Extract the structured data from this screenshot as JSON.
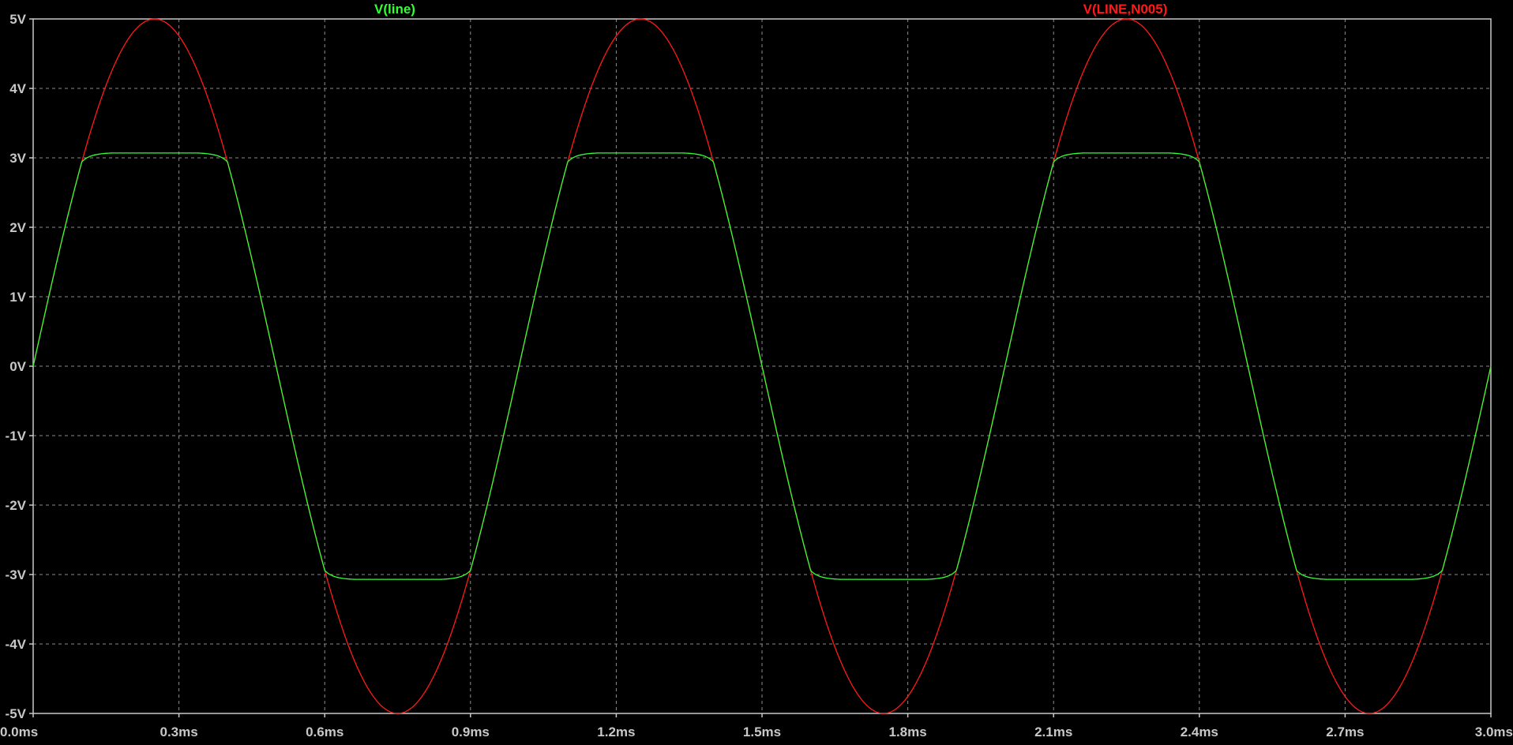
{
  "chart_data": {
    "type": "line",
    "title": "",
    "xlabel": "",
    "ylabel": "",
    "grid": true,
    "legend_placement": "top",
    "x_unit": "ms",
    "y_unit": "V",
    "xlim": [
      0,
      3.0
    ],
    "ylim": [
      -5,
      5
    ],
    "x_ticks": [
      0.0,
      0.3,
      0.6,
      0.9,
      1.2,
      1.5,
      1.8,
      2.1,
      2.4,
      2.7,
      3.0
    ],
    "x_tick_labels": [
      "0.0ms",
      "0.3ms",
      "0.6ms",
      "0.9ms",
      "1.2ms",
      "1.5ms",
      "1.8ms",
      "2.1ms",
      "2.4ms",
      "2.7ms",
      "3.0ms"
    ],
    "y_ticks": [
      5,
      4,
      3,
      2,
      1,
      0,
      -1,
      -2,
      -3,
      -4,
      -5
    ],
    "y_tick_labels": [
      "5V",
      "4V",
      "3V",
      "2V",
      "1V",
      "0V",
      "-1V",
      "-2V",
      "-3V",
      "-4V",
      "-5V"
    ],
    "series": [
      {
        "name": "V(LINE,N005)",
        "color": "#ff1a1a",
        "x": [
          0.0,
          0.05,
          0.1,
          0.15,
          0.2,
          0.25,
          0.3,
          0.35,
          0.4,
          0.45,
          0.5,
          0.55,
          0.6,
          0.65,
          0.7,
          0.75,
          0.8,
          0.85,
          0.9,
          0.95,
          1.0,
          1.05,
          1.1,
          1.15,
          1.2,
          1.25,
          1.3,
          1.35,
          1.4,
          1.45,
          1.5,
          1.55,
          1.6,
          1.65,
          1.7,
          1.75,
          1.8,
          1.85,
          1.9,
          1.95,
          2.0,
          2.05,
          2.1,
          2.15,
          2.2,
          2.25,
          2.3,
          2.35,
          2.4,
          2.45,
          2.5,
          2.55,
          2.6,
          2.65,
          2.7,
          2.75,
          2.8,
          2.85,
          2.9,
          2.95,
          3.0
        ],
        "y": [
          0,
          1.55,
          2.94,
          4.05,
          4.76,
          5.0,
          4.76,
          4.05,
          2.94,
          1.55,
          0,
          -1.55,
          -2.94,
          -4.05,
          -4.76,
          -5.0,
          -4.76,
          -4.05,
          -2.94,
          -1.55,
          0,
          1.55,
          2.94,
          4.05,
          4.76,
          5.0,
          4.76,
          4.05,
          2.94,
          1.55,
          0,
          -1.55,
          -2.94,
          -4.05,
          -4.76,
          -5.0,
          -4.76,
          -4.05,
          -2.94,
          -1.55,
          0,
          1.55,
          2.94,
          4.05,
          4.76,
          5.0,
          4.76,
          4.05,
          2.94,
          1.55,
          0,
          -1.55,
          -2.94,
          -4.05,
          -4.76,
          -5.0,
          -4.76,
          -4.05,
          -2.94,
          -1.55,
          0
        ]
      },
      {
        "name": "V(line)",
        "color": "#33ff33",
        "x": [
          0.0,
          0.05,
          0.1,
          0.15,
          0.2,
          0.25,
          0.3,
          0.35,
          0.4,
          0.45,
          0.5,
          0.55,
          0.6,
          0.65,
          0.7,
          0.75,
          0.8,
          0.85,
          0.9,
          0.95,
          1.0,
          1.05,
          1.1,
          1.15,
          1.2,
          1.25,
          1.3,
          1.35,
          1.4,
          1.45,
          1.5,
          1.55,
          1.6,
          1.65,
          1.7,
          1.75,
          1.8,
          1.85,
          1.9,
          1.95,
          2.0,
          2.05,
          2.1,
          2.15,
          2.2,
          2.25,
          2.3,
          2.35,
          2.4,
          2.45,
          2.5,
          2.55,
          2.6,
          2.65,
          2.7,
          2.75,
          2.8,
          2.85,
          2.9,
          2.95,
          3.0
        ],
        "y": [
          0,
          1.55,
          2.94,
          3.05,
          3.07,
          3.07,
          3.07,
          3.05,
          2.94,
          1.55,
          0,
          -1.55,
          -2.94,
          -3.05,
          -3.07,
          -3.07,
          -3.07,
          -3.05,
          -2.94,
          -1.55,
          0,
          1.55,
          2.94,
          3.05,
          3.07,
          3.07,
          3.07,
          3.05,
          2.94,
          1.55,
          0,
          -1.55,
          -2.94,
          -3.05,
          -3.07,
          -3.07,
          -3.07,
          -3.05,
          -2.94,
          -1.55,
          0,
          1.55,
          2.94,
          3.05,
          3.07,
          3.07,
          3.07,
          3.05,
          2.94,
          1.55,
          0,
          -1.55,
          -2.94,
          -3.05,
          -3.07,
          -3.07,
          -3.07,
          -3.05,
          -2.94,
          -1.55,
          0
        ]
      }
    ]
  },
  "colors": {
    "background": "#000000",
    "frame": "#c8c8c8",
    "grid": "#8c8c8c",
    "tick_text": "#c8c8c8"
  }
}
